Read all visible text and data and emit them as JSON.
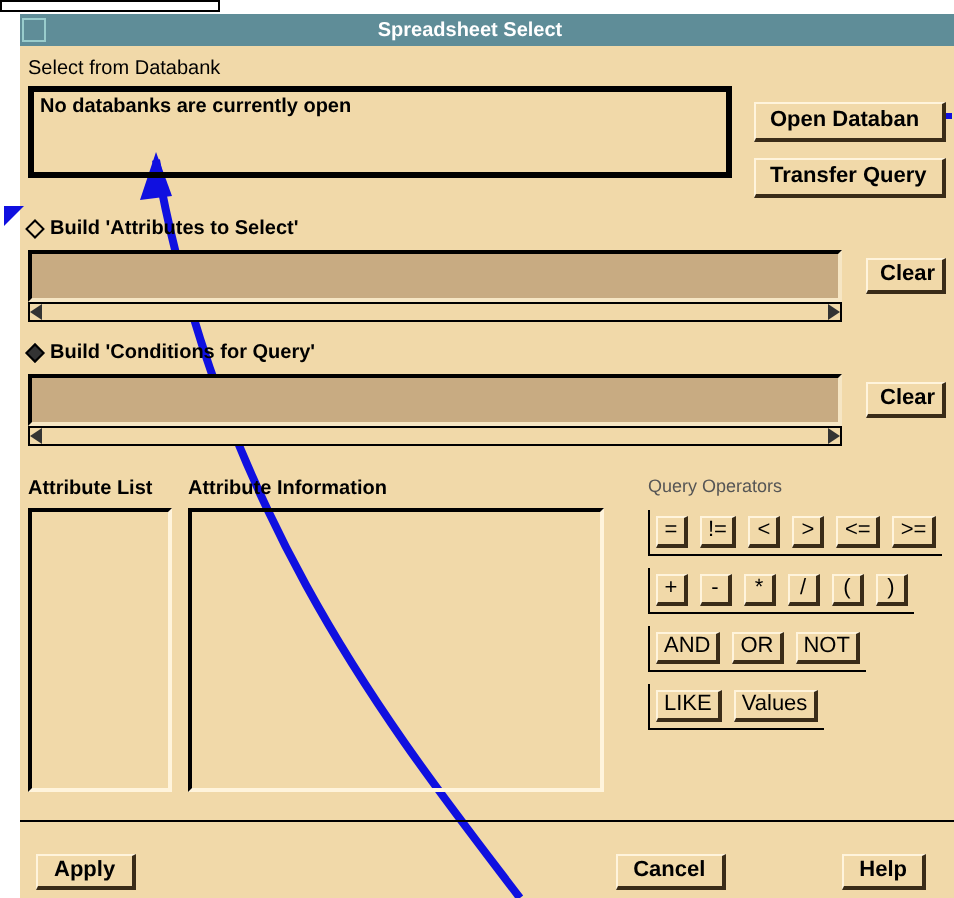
{
  "window": {
    "title": "Spreadsheet Select"
  },
  "databank": {
    "label": "Select from Databank",
    "message": "No databanks are currently open"
  },
  "side_buttons": [
    "Open Databan",
    "Transfer Query"
  ],
  "builders": [
    {
      "label": "Build 'Attributes to Select'",
      "selected": false,
      "clear": "Clear"
    },
    {
      "label": "Build 'Conditions for Query'",
      "selected": true,
      "clear": "Clear"
    }
  ],
  "attribute_list": {
    "label": "Attribute List"
  },
  "attribute_information": {
    "label": "Attribute Information"
  },
  "query_operators": {
    "label": "Query Operators",
    "groups": [
      [
        "=",
        "!=",
        "<",
        ">",
        "<=",
        ">="
      ],
      [
        "+",
        "-",
        "*",
        "/",
        "(",
        ")"
      ],
      [
        "AND",
        "OR",
        "NOT"
      ],
      [
        "LIKE",
        "Values"
      ]
    ]
  },
  "footer_buttons": [
    "Apply",
    "Cancel",
    "Help"
  ]
}
